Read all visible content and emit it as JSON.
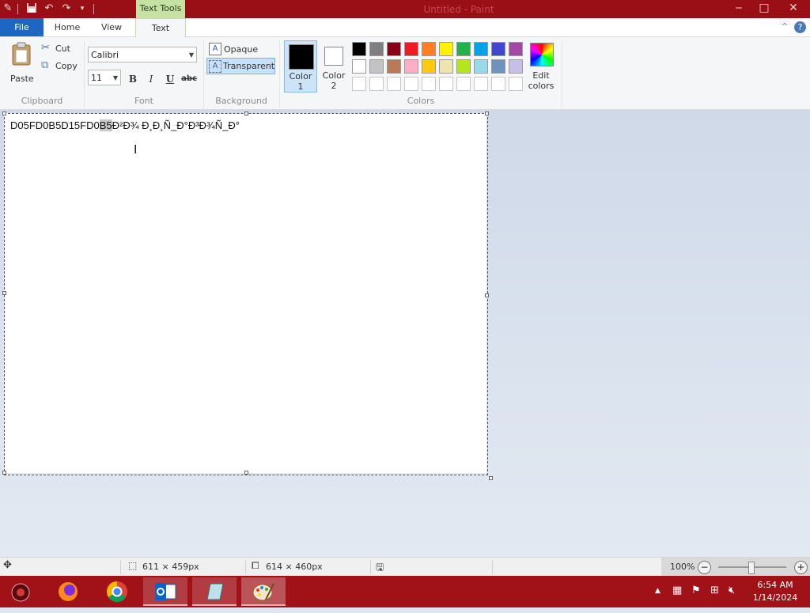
{
  "titlebar": {
    "contextual_tab": "Text Tools",
    "window_title": "Untitled - Paint",
    "minimize": "‒",
    "maximize": "□",
    "close": "✕"
  },
  "tabs": {
    "file": "File",
    "home": "Home",
    "view": "View",
    "text": "Text",
    "collapse_icon": "^",
    "help_icon": "?"
  },
  "clipboard": {
    "paste": "Paste",
    "cut": "Cut",
    "copy": "Copy",
    "label": "Clipboard"
  },
  "font": {
    "family": "Calibri",
    "size": "11",
    "bold": "B",
    "italic": "I",
    "underline": "U",
    "strike": "abc",
    "label": "Font"
  },
  "background": {
    "opaque": "Opaque",
    "transparent": "Transparent",
    "label": "Background"
  },
  "colors": {
    "color1_line1": "Color",
    "color1_line2": "1",
    "color2_line1": "Color",
    "color2_line2": "2",
    "edit_line1": "Edit",
    "edit_line2": "colors",
    "label": "Colors",
    "color1_value": "#000000",
    "color2_value": "#ffffff",
    "palette_row1": [
      "#000000",
      "#7f7f7f",
      "#880015",
      "#ed1c24",
      "#ff7f27",
      "#fff200",
      "#22b14c",
      "#00a2e8",
      "#3f48cc",
      "#a349a4"
    ],
    "palette_row2": [
      "#ffffff",
      "#c3c3c3",
      "#b97a57",
      "#ffaec9",
      "#ffc90e",
      "#efe4b0",
      "#b5e61d",
      "#99d9ea",
      "#7092be",
      "#c8bfe7"
    ],
    "palette_row3": [
      "#ffffff",
      "#ffffff",
      "#ffffff",
      "#ffffff",
      "#ffffff",
      "#ffffff",
      "#ffffff",
      "#ffffff",
      "#ffffff",
      "#ffffff"
    ]
  },
  "canvas": {
    "text_before": "D05FD0B5D15FD0",
    "text_selected": "B5",
    "text_after": "Ð²Ð¾ Ð¸Ð¸Ñ_Ð°Ð³Ð¾Ñ_Ð°"
  },
  "status": {
    "selection_size": "611 × 459px",
    "canvas_size": "614 × 460px",
    "zoom": "100%"
  },
  "taskbar": {
    "time": "6:54 AM",
    "date": "1/14/2024"
  }
}
